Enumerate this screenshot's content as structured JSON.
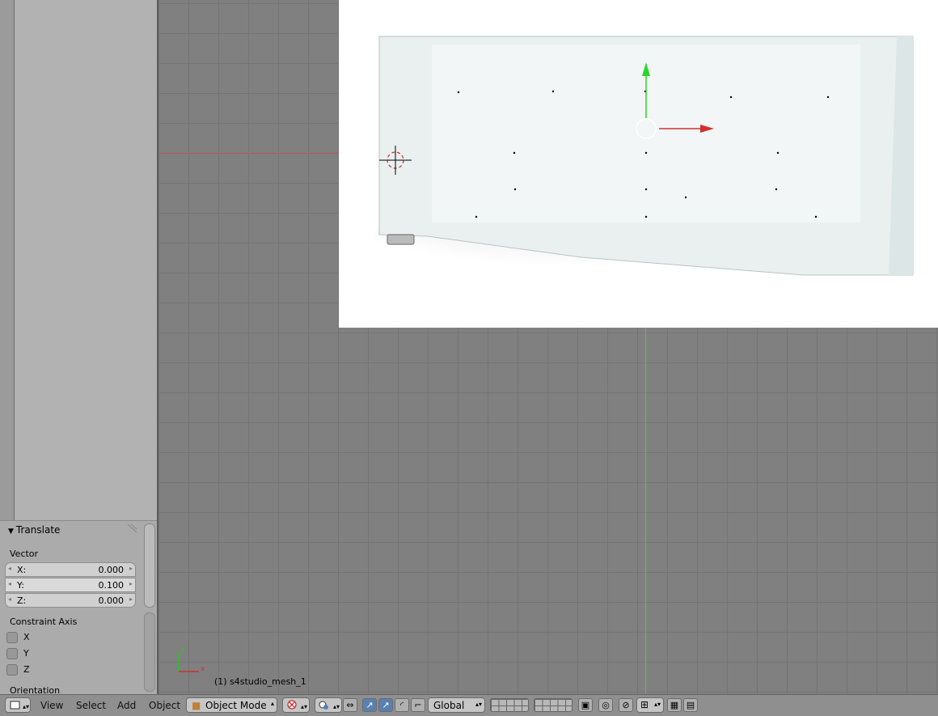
{
  "operator_panel": {
    "title": "Translate",
    "vector_label": "Vector",
    "x_label": "X:",
    "x_value": "0.000",
    "y_label": "Y:",
    "y_value": "0.100",
    "z_label": "Z:",
    "z_value": "0.000",
    "constraint_label": "Constraint Axis",
    "constraint_x": "X",
    "constraint_y": "Y",
    "constraint_z": "Z",
    "orientation_label": "Orientation"
  },
  "viewport": {
    "object_name": "(1) s4studio_mesh_1",
    "axis_x": "x",
    "axis_y": "y"
  },
  "header": {
    "menu_view": "View",
    "menu_select": "Select",
    "menu_add": "Add",
    "menu_object": "Object",
    "mode": "Object Mode",
    "orientation": "Global"
  },
  "colors": {
    "x_axis": "#d03030",
    "y_axis": "#30d030",
    "active_button": "#5a80b0"
  }
}
